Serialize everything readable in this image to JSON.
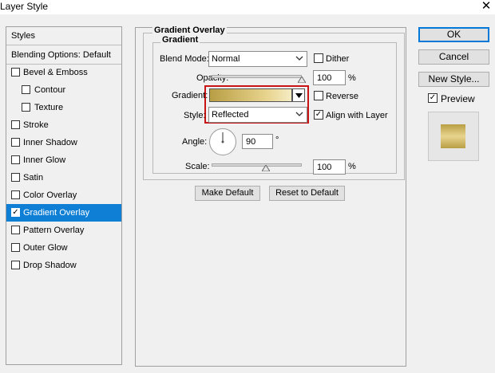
{
  "window": {
    "title": "Layer Style",
    "close_glyph": "✕"
  },
  "left_panel": {
    "styles_header": "Styles",
    "blending_header": "Blending Options: Default",
    "items": [
      {
        "label": "Bevel & Emboss",
        "checked": false,
        "indent": false
      },
      {
        "label": "Contour",
        "checked": false,
        "indent": true
      },
      {
        "label": "Texture",
        "checked": false,
        "indent": true
      },
      {
        "label": "Stroke",
        "checked": false,
        "indent": false
      },
      {
        "label": "Inner Shadow",
        "checked": false,
        "indent": false
      },
      {
        "label": "Inner Glow",
        "checked": false,
        "indent": false
      },
      {
        "label": "Satin",
        "checked": false,
        "indent": false
      },
      {
        "label": "Color Overlay",
        "checked": false,
        "indent": false
      },
      {
        "label": "Gradient Overlay",
        "checked": true,
        "indent": false,
        "selected": true
      },
      {
        "label": "Pattern Overlay",
        "checked": false,
        "indent": false
      },
      {
        "label": "Outer Glow",
        "checked": false,
        "indent": false
      },
      {
        "label": "Drop Shadow",
        "checked": false,
        "indent": false
      }
    ],
    "check_glyph": "✓",
    "selection_color": "#0f7fd6"
  },
  "gradient_overlay": {
    "group_title": "Gradient Overlay",
    "subgroup_title": "Gradient",
    "blend_mode_label": "Blend Mode:",
    "blend_mode_value": "Normal",
    "dither_label": "Dither",
    "dither_checked": false,
    "opacity_label": "Opacity:",
    "opacity_value": "100",
    "opacity_unit": "%",
    "opacity_fraction": 1.0,
    "gradient_label": "Gradient:",
    "gradient_colors": [
      "#b89e44",
      "#e8d48e",
      "#f5ecc4"
    ],
    "reverse_label": "Reverse",
    "reverse_checked": false,
    "style_label": "Style:",
    "style_value": "Reflected",
    "align_label": "Align with Layer",
    "align_checked": true,
    "angle_label": "Angle:",
    "angle_value": "90",
    "angle_unit": "°",
    "scale_label": "Scale:",
    "scale_value": "100",
    "scale_unit": "%",
    "scale_fraction": 0.6,
    "make_default_label": "Make Default",
    "reset_default_label": "Reset to Default",
    "highlight_color": "#c81414"
  },
  "right_panel": {
    "ok_label": "OK",
    "cancel_label": "Cancel",
    "new_style_label": "New Style...",
    "preview_label": "Preview",
    "preview_checked": true
  }
}
